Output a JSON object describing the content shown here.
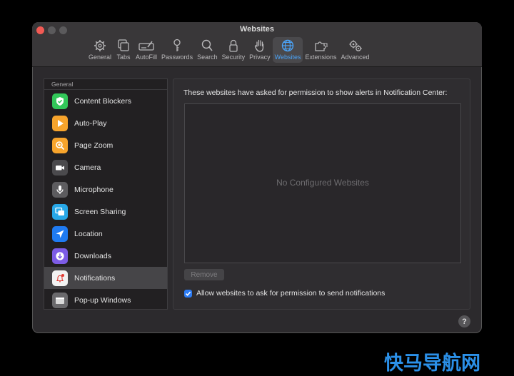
{
  "window": {
    "title": "Websites"
  },
  "toolbar": {
    "items": [
      {
        "label": "General",
        "icon": "gear-icon"
      },
      {
        "label": "Tabs",
        "icon": "tabs-icon"
      },
      {
        "label": "AutoFill",
        "icon": "autofill-icon"
      },
      {
        "label": "Passwords",
        "icon": "key-icon"
      },
      {
        "label": "Search",
        "icon": "search-icon"
      },
      {
        "label": "Security",
        "icon": "lock-icon"
      },
      {
        "label": "Privacy",
        "icon": "hand-icon"
      },
      {
        "label": "Websites",
        "icon": "globe-icon",
        "active": true
      },
      {
        "label": "Extensions",
        "icon": "puzzle-icon"
      },
      {
        "label": "Advanced",
        "icon": "gears-icon"
      }
    ]
  },
  "sidebar": {
    "header": "General",
    "items": [
      {
        "label": "Content Blockers",
        "icon": "shield-check-icon",
        "color": "#32c759"
      },
      {
        "label": "Auto-Play",
        "icon": "play-icon",
        "color": "#f7a42c"
      },
      {
        "label": "Page Zoom",
        "icon": "zoom-icon",
        "color": "#f7a42c"
      },
      {
        "label": "Camera",
        "icon": "camera-icon",
        "color": "#4b4a4d"
      },
      {
        "label": "Microphone",
        "icon": "microphone-icon",
        "color": "#5d5c5f"
      },
      {
        "label": "Screen Sharing",
        "icon": "screen-sharing-icon",
        "color": "#27a8e8"
      },
      {
        "label": "Location",
        "icon": "location-arrow-icon",
        "color": "#1f7bf2"
      },
      {
        "label": "Downloads",
        "icon": "download-icon",
        "color": "#7d5ce6"
      },
      {
        "label": "Notifications",
        "icon": "notification-bell-icon",
        "color": "#f2f2f2",
        "selected": true
      },
      {
        "label": "Pop-up Windows",
        "icon": "popup-windows-icon",
        "color": "#6a696c"
      }
    ]
  },
  "content": {
    "description": "These websites have asked for permission to show alerts in Notification Center:",
    "empty_message": "No Configured Websites",
    "remove_label": "Remove",
    "checkbox_label": "Allow websites to ask for permission to send notifications",
    "checkbox_checked": true
  },
  "help": {
    "label": "?"
  },
  "watermark": {
    "text": "快马导航网"
  }
}
